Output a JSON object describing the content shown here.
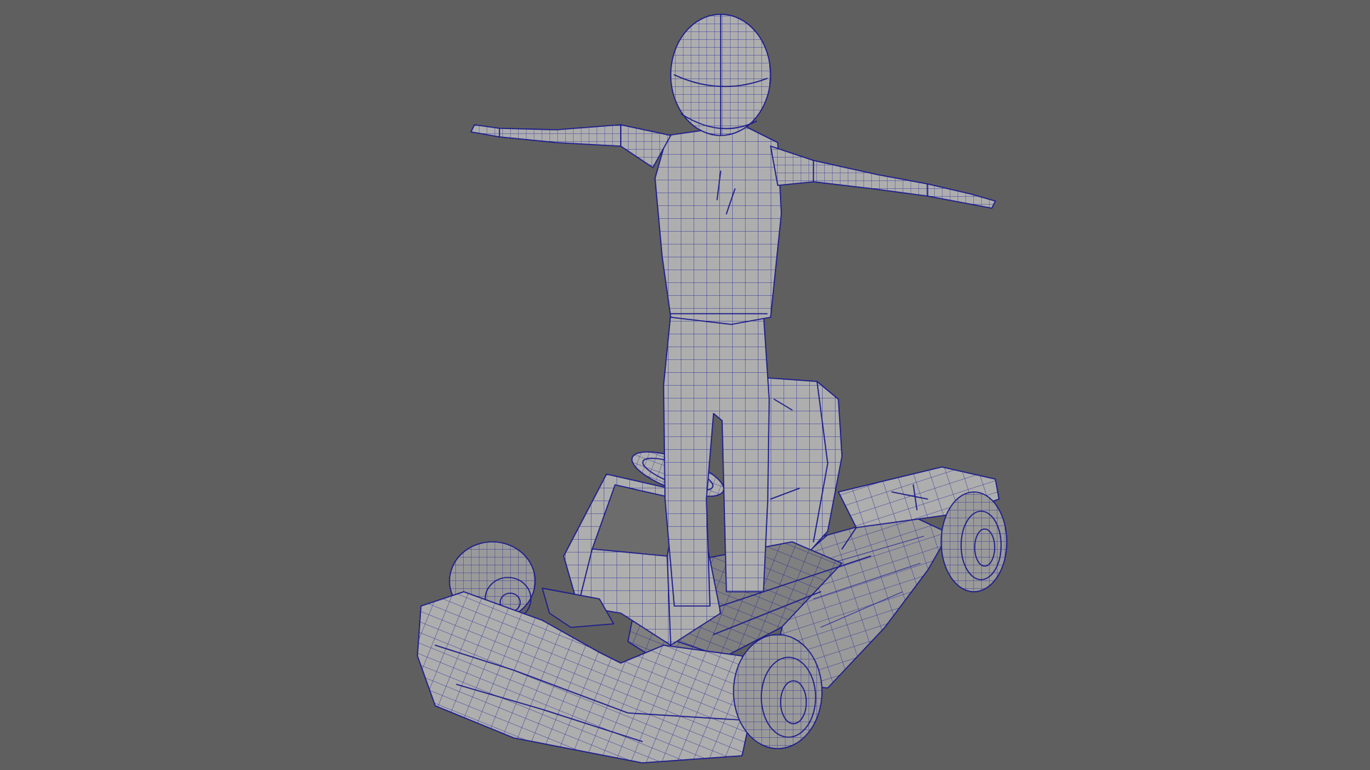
{
  "viewport": {
    "background_color": "#5f5f5f",
    "wire_color": "#1e1e8c",
    "surface_color": "#aeaeae",
    "objects": [
      {
        "name": "character-mesh",
        "label": ""
      },
      {
        "name": "go-kart-mesh",
        "label": ""
      }
    ]
  }
}
